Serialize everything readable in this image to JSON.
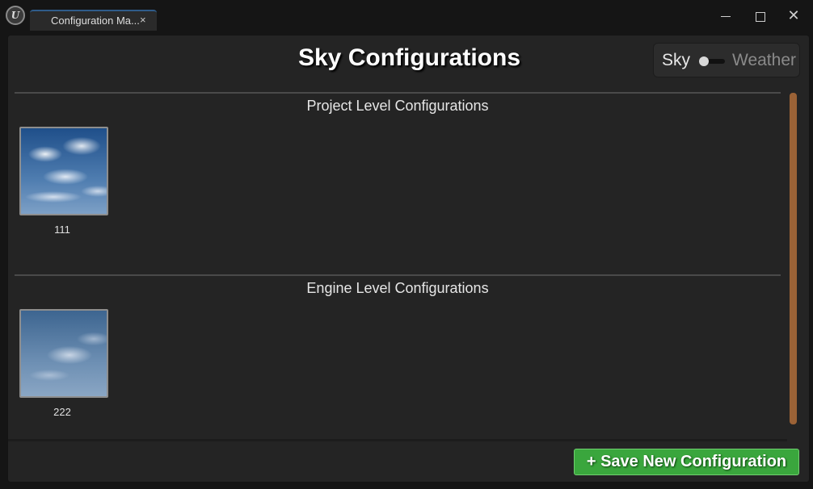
{
  "window": {
    "tab_title": "Configuration Ma...",
    "tab_close": "×",
    "close_glyph": "✕"
  },
  "header": {
    "title": "Sky Configurations",
    "toggle": {
      "left_label": "Sky",
      "right_label": "Weather",
      "selected": "Sky"
    }
  },
  "sections": [
    {
      "title": "Project Level Configurations",
      "items": [
        {
          "label": "111"
        }
      ]
    },
    {
      "title": "Engine Level Configurations",
      "items": [
        {
          "label": "222"
        }
      ]
    }
  ],
  "footer": {
    "save_label": "+ Save New Configuration"
  },
  "colors": {
    "panel": "#242424",
    "accent_green": "#3aa63d",
    "scrollbar": "#9b6236",
    "tab_accent": "#2f5c8a"
  }
}
